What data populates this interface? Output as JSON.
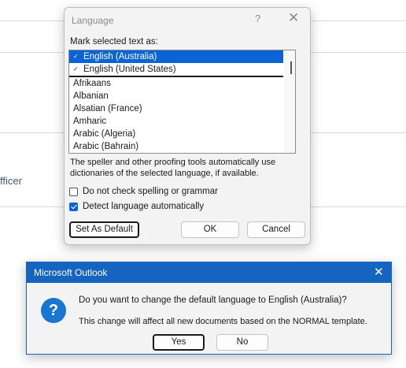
{
  "background": {
    "partial_text": "fficer"
  },
  "language_dialog": {
    "title": "Language",
    "help_glyph": "?",
    "close_glyph": "✕",
    "mark_label": "Mark selected text as:",
    "languages": [
      {
        "label": "English (Australia)",
        "selected": true,
        "spell_glyph": "✓"
      },
      {
        "label": "English (United States)",
        "selected": false,
        "spell_glyph": "✓",
        "default": true
      },
      {
        "label": "Afrikaans"
      },
      {
        "label": "Albanian"
      },
      {
        "label": "Alsatian (France)"
      },
      {
        "label": "Amharic"
      },
      {
        "label": "Arabic (Algeria)"
      },
      {
        "label": "Arabic (Bahrain)"
      }
    ],
    "description": "The speller and other proofing tools automatically use dictionaries of the selected language, if available.",
    "check_no_spelling": {
      "label": "Do not check spelling or grammar",
      "checked": false
    },
    "check_detect": {
      "label": "Detect language automatically",
      "checked": true
    },
    "buttons": {
      "set_default": "Set As Default",
      "ok": "OK",
      "cancel": "Cancel"
    }
  },
  "outlook_dialog": {
    "title": "Microsoft Outlook",
    "close_glyph": "✕",
    "icon": "question-icon",
    "icon_glyph": "?",
    "question": "Do you want to change the default language to English (Australia)?",
    "note": "This change will affect all new documents based on the NORMAL template.",
    "buttons": {
      "yes": "Yes",
      "no": "No"
    }
  },
  "colors": {
    "accent": "#0a64d6",
    "titlebar": "#1565c0"
  }
}
